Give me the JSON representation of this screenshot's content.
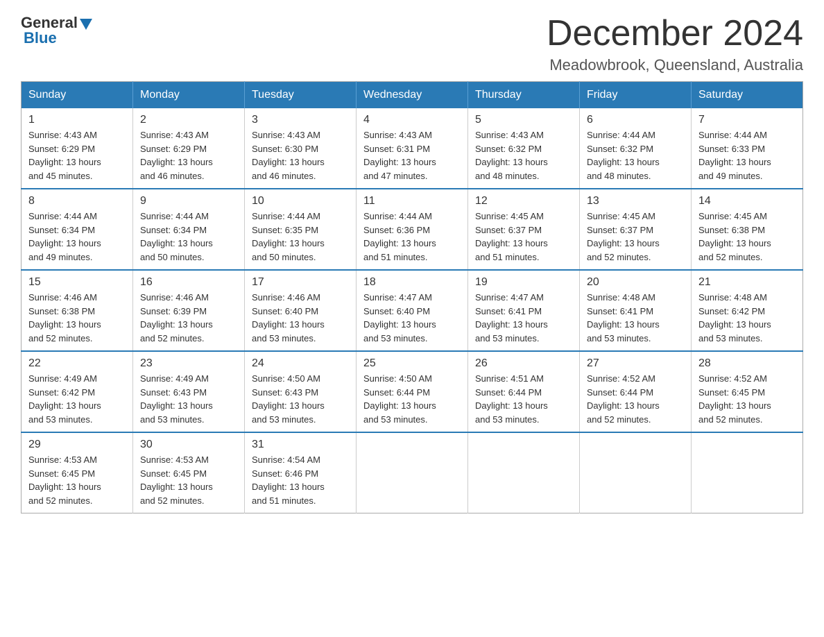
{
  "header": {
    "logo": {
      "general": "General",
      "blue": "Blue"
    },
    "title": "December 2024",
    "subtitle": "Meadowbrook, Queensland, Australia"
  },
  "weekdays": [
    "Sunday",
    "Monday",
    "Tuesday",
    "Wednesday",
    "Thursday",
    "Friday",
    "Saturday"
  ],
  "weeks": [
    [
      {
        "day": "1",
        "sunrise": "4:43 AM",
        "sunset": "6:29 PM",
        "daylight": "13 hours and 45 minutes."
      },
      {
        "day": "2",
        "sunrise": "4:43 AM",
        "sunset": "6:29 PM",
        "daylight": "13 hours and 46 minutes."
      },
      {
        "day": "3",
        "sunrise": "4:43 AM",
        "sunset": "6:30 PM",
        "daylight": "13 hours and 46 minutes."
      },
      {
        "day": "4",
        "sunrise": "4:43 AM",
        "sunset": "6:31 PM",
        "daylight": "13 hours and 47 minutes."
      },
      {
        "day": "5",
        "sunrise": "4:43 AM",
        "sunset": "6:32 PM",
        "daylight": "13 hours and 48 minutes."
      },
      {
        "day": "6",
        "sunrise": "4:44 AM",
        "sunset": "6:32 PM",
        "daylight": "13 hours and 48 minutes."
      },
      {
        "day": "7",
        "sunrise": "4:44 AM",
        "sunset": "6:33 PM",
        "daylight": "13 hours and 49 minutes."
      }
    ],
    [
      {
        "day": "8",
        "sunrise": "4:44 AM",
        "sunset": "6:34 PM",
        "daylight": "13 hours and 49 minutes."
      },
      {
        "day": "9",
        "sunrise": "4:44 AM",
        "sunset": "6:34 PM",
        "daylight": "13 hours and 50 minutes."
      },
      {
        "day": "10",
        "sunrise": "4:44 AM",
        "sunset": "6:35 PM",
        "daylight": "13 hours and 50 minutes."
      },
      {
        "day": "11",
        "sunrise": "4:44 AM",
        "sunset": "6:36 PM",
        "daylight": "13 hours and 51 minutes."
      },
      {
        "day": "12",
        "sunrise": "4:45 AM",
        "sunset": "6:37 PM",
        "daylight": "13 hours and 51 minutes."
      },
      {
        "day": "13",
        "sunrise": "4:45 AM",
        "sunset": "6:37 PM",
        "daylight": "13 hours and 52 minutes."
      },
      {
        "day": "14",
        "sunrise": "4:45 AM",
        "sunset": "6:38 PM",
        "daylight": "13 hours and 52 minutes."
      }
    ],
    [
      {
        "day": "15",
        "sunrise": "4:46 AM",
        "sunset": "6:38 PM",
        "daylight": "13 hours and 52 minutes."
      },
      {
        "day": "16",
        "sunrise": "4:46 AM",
        "sunset": "6:39 PM",
        "daylight": "13 hours and 52 minutes."
      },
      {
        "day": "17",
        "sunrise": "4:46 AM",
        "sunset": "6:40 PM",
        "daylight": "13 hours and 53 minutes."
      },
      {
        "day": "18",
        "sunrise": "4:47 AM",
        "sunset": "6:40 PM",
        "daylight": "13 hours and 53 minutes."
      },
      {
        "day": "19",
        "sunrise": "4:47 AM",
        "sunset": "6:41 PM",
        "daylight": "13 hours and 53 minutes."
      },
      {
        "day": "20",
        "sunrise": "4:48 AM",
        "sunset": "6:41 PM",
        "daylight": "13 hours and 53 minutes."
      },
      {
        "day": "21",
        "sunrise": "4:48 AM",
        "sunset": "6:42 PM",
        "daylight": "13 hours and 53 minutes."
      }
    ],
    [
      {
        "day": "22",
        "sunrise": "4:49 AM",
        "sunset": "6:42 PM",
        "daylight": "13 hours and 53 minutes."
      },
      {
        "day": "23",
        "sunrise": "4:49 AM",
        "sunset": "6:43 PM",
        "daylight": "13 hours and 53 minutes."
      },
      {
        "day": "24",
        "sunrise": "4:50 AM",
        "sunset": "6:43 PM",
        "daylight": "13 hours and 53 minutes."
      },
      {
        "day": "25",
        "sunrise": "4:50 AM",
        "sunset": "6:44 PM",
        "daylight": "13 hours and 53 minutes."
      },
      {
        "day": "26",
        "sunrise": "4:51 AM",
        "sunset": "6:44 PM",
        "daylight": "13 hours and 53 minutes."
      },
      {
        "day": "27",
        "sunrise": "4:52 AM",
        "sunset": "6:44 PM",
        "daylight": "13 hours and 52 minutes."
      },
      {
        "day": "28",
        "sunrise": "4:52 AM",
        "sunset": "6:45 PM",
        "daylight": "13 hours and 52 minutes."
      }
    ],
    [
      {
        "day": "29",
        "sunrise": "4:53 AM",
        "sunset": "6:45 PM",
        "daylight": "13 hours and 52 minutes."
      },
      {
        "day": "30",
        "sunrise": "4:53 AM",
        "sunset": "6:45 PM",
        "daylight": "13 hours and 52 minutes."
      },
      {
        "day": "31",
        "sunrise": "4:54 AM",
        "sunset": "6:46 PM",
        "daylight": "13 hours and 51 minutes."
      },
      null,
      null,
      null,
      null
    ]
  ],
  "labels": {
    "sunrise_prefix": "Sunrise: ",
    "sunset_prefix": "Sunset: ",
    "daylight_prefix": "Daylight: "
  }
}
